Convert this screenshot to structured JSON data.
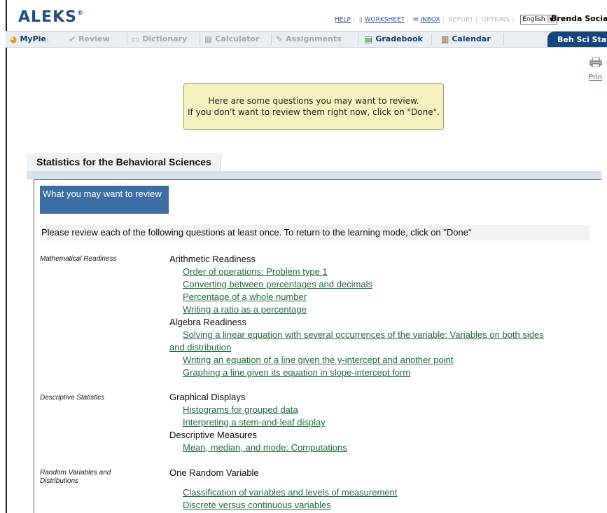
{
  "header": {
    "logo": "ALEKS",
    "logo_mark": "®",
    "links": {
      "help": "HELP",
      "worksheet": "WORKSHEET",
      "inbox": "INBOX",
      "report": "REPORT",
      "options": "OPTIONS"
    },
    "language": "English",
    "user": "Brenda Social"
  },
  "nav": {
    "items": [
      {
        "label": "MyPie",
        "icon": "pie-icon",
        "active": true
      },
      {
        "label": "Review",
        "icon": "checkmark-icon",
        "active": false
      },
      {
        "label": "Dictionary",
        "icon": "book-icon",
        "active": false
      },
      {
        "label": "Calculator",
        "icon": "calculator-icon",
        "active": false
      },
      {
        "label": "Assignments",
        "icon": "assignment-icon",
        "active": false
      },
      {
        "label": "Gradebook",
        "icon": "gradebook-icon",
        "active": true
      },
      {
        "label": "Calendar",
        "icon": "calendar-icon",
        "active": true
      }
    ],
    "course_tab": "Beh Sci Stat"
  },
  "print_label": "Prin",
  "notice": {
    "line1": "Here are some questions you may want to review.",
    "line2": "If you don't want to review them right now, click on \"Done\"."
  },
  "course": {
    "title": "Statistics for the Behavioral Sciences"
  },
  "review": {
    "header": "What you may want to review",
    "instructions": "Please review each of the following questions at least once. To return to the learning mode, click on \"Done\"",
    "categories": [
      {
        "name": "Mathematical Readiness",
        "groups": [
          {
            "title": "Arithmetic Readiness",
            "topics": [
              "Order of operations: Problem type 1",
              "Converting between percentages and decimals",
              "Percentage of a whole number",
              "Writing a ratio as a percentage"
            ]
          },
          {
            "title": "Algebra Readiness",
            "topics": [
              "Solving a linear equation with several occurrences of the variable: Variables on both sides",
              "and distribution",
              "Writing an equation of a line given the y-intercept and another point",
              "Graphing a line given its equation in slope-intercept form"
            ]
          }
        ]
      },
      {
        "name": "Descriptive Statistics",
        "groups": [
          {
            "title": "Graphical Displays",
            "topics": [
              "Histograms for grouped data",
              "Interpreting a stem-and-leaf display"
            ]
          },
          {
            "title": "Descriptive Measures",
            "topics": [
              "Mean, median, and mode: Computations"
            ]
          }
        ]
      },
      {
        "name": "Random Variables and Distributions",
        "groups": [
          {
            "title": "One Random Variable",
            "topics": [
              "Classification of variables and levels of measurement",
              "Discrete versus continuous variables"
            ]
          }
        ]
      }
    ]
  },
  "colors": {
    "brand": "#1d4f86",
    "course_tab": "#15467c",
    "review_header": "#3c6ea5",
    "link": "#1e6b3a",
    "notice_bg": "#f6f2bf"
  }
}
